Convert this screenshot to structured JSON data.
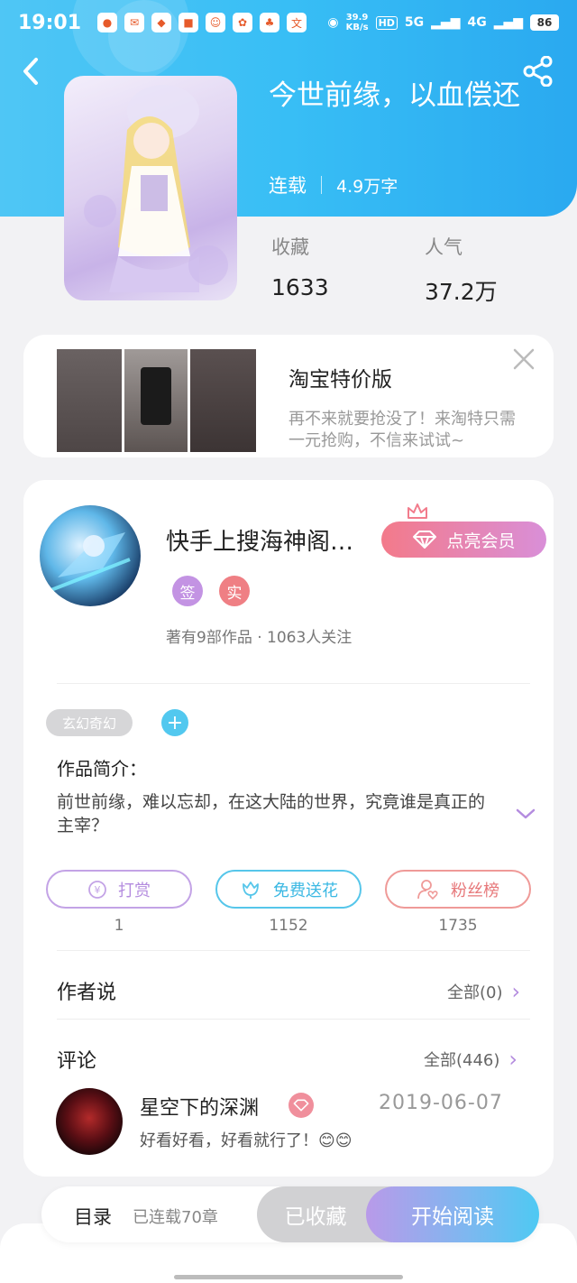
{
  "status_bar": {
    "time": "19:01",
    "app_icons": [
      "app-1",
      "app-2",
      "app-3",
      "app-4",
      "app-5",
      "app-6",
      "app-7",
      "app-8"
    ],
    "net_speed_value": "39.9",
    "net_speed_unit": "KB/s",
    "hd_label": "HD",
    "signal_1": "5G",
    "signal_2": "4G",
    "battery": "86"
  },
  "book": {
    "title": "今世前缘，以血偿还",
    "status": "连载",
    "word_count": "4.9万字",
    "stats": [
      {
        "label": "收藏",
        "value": "1633"
      },
      {
        "label": "人气",
        "value": "37.2万"
      }
    ]
  },
  "ad": {
    "title": "淘宝特价版",
    "desc_line1": "再不来就要抢没了！来淘特只需",
    "desc_line2": "一元抢购，不信来试试~"
  },
  "author": {
    "name": "快手上搜海神阁…",
    "vip_button": "点亮会员",
    "badges": [
      "签",
      "实"
    ],
    "stats_text": "著有9部作品 · 1063人关注"
  },
  "genre_tag": "玄幻奇幻",
  "intro": {
    "label": "作品简介：",
    "text": "前世前缘，难以忘却，在这大陆的世界，究竟谁是真正的主宰？"
  },
  "actions": [
    {
      "label": "打赏",
      "count": "1",
      "color": "#c3a3e6"
    },
    {
      "label": "免费送花",
      "count": "1152",
      "color": "#56c6ea"
    },
    {
      "label": "粉丝榜",
      "count": "1735",
      "color": "#ef9a98"
    }
  ],
  "author_says": {
    "title": "作者说",
    "link": "全部(0)"
  },
  "comments": {
    "title": "评论",
    "link": "全部(446)",
    "first": {
      "user": "星空下的深渊",
      "date": "2019-06-07",
      "text": "好看好看，好看就行了！😊😊"
    }
  },
  "bottom_bar": {
    "toc": "目录",
    "chapters": "已连载70章",
    "collected": "已收藏",
    "read": "开始阅读"
  },
  "colors": {
    "header": "#38bef5",
    "accent_purple": "#b48cdf",
    "badge_sign": "#c393e3",
    "badge_real": "#ef7f84",
    "vip_start": "#f37a8a",
    "vip_end": "#d98fd8"
  }
}
